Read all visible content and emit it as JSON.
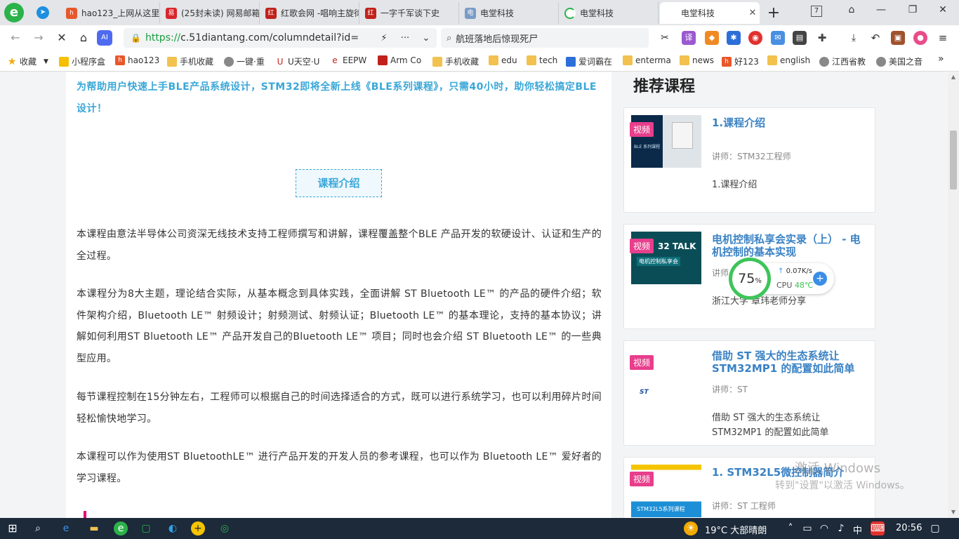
{
  "browser": {
    "tabs": [
      {
        "title": "hao123_上网从这里开始",
        "favicon": "hao123-icon",
        "active": false
      },
      {
        "title": "(25封未读) 网易邮箱",
        "favicon": "netease-mail-icon",
        "active": false
      },
      {
        "title": "红歌会网 -唱响主旋律",
        "favicon": "hongge-icon",
        "active": false
      },
      {
        "title": "一字千军谈下史",
        "favicon": "hongge-icon",
        "active": false
      },
      {
        "title": "电堂科技",
        "favicon": "diantang-icon",
        "active": false
      },
      {
        "title": "电堂科技",
        "favicon": "loading-icon",
        "active": false
      },
      {
        "title": "电堂科技",
        "favicon": "diantang-icon",
        "active": true
      }
    ],
    "pinned_tab_count": "7",
    "url_secure_part": "https://",
    "url_rest": "c.51diantang.com/columndetail?id=",
    "search_text": "航班落地后惊现死尸"
  },
  "bookmarks": [
    {
      "label": "收藏",
      "icon": "star-icon"
    },
    {
      "label": "小程序盒",
      "icon": "shield-icon"
    },
    {
      "label": "hao123",
      "icon": "hao123-icon"
    },
    {
      "label": "手机收藏",
      "icon": "folder-icon"
    },
    {
      "label": "一键·重",
      "icon": "globe-icon"
    },
    {
      "label": "U天空·U",
      "icon": "u-icon"
    },
    {
      "label": "EEPW",
      "icon": "eepw-icon"
    },
    {
      "label": "Arm Co",
      "icon": "arm-icon"
    },
    {
      "label": "手机收藏",
      "icon": "folder-icon"
    },
    {
      "label": "edu",
      "icon": "folder-icon"
    },
    {
      "label": "tech",
      "icon": "folder-icon"
    },
    {
      "label": "爱词霸在",
      "icon": "iciba-icon"
    },
    {
      "label": "enterma",
      "icon": "folder-icon"
    },
    {
      "label": "news",
      "icon": "folder-icon"
    },
    {
      "label": "好123",
      "icon": "hao123-icon"
    },
    {
      "label": "english",
      "icon": "folder-icon"
    },
    {
      "label": "江西省教",
      "icon": "globe-icon"
    },
    {
      "label": "美国之音",
      "icon": "globe-icon"
    }
  ],
  "article": {
    "intro": "为帮助用户快速上手BLE产品系统设计，STM32即将全新上线《BLE系列课程》，只需40小时，助你轻松搞定BLE设计！",
    "section_title": "课程介绍",
    "paragraphs": [
      "本课程由意法半导体公司资深无线技术支持工程师撰写和讲解，课程覆盖整个BLE 产品开发的软硬设计、认证和生产的全过程。",
      "本课程分为8大主题，理论结合实际，从基本概念到具体实践，全面讲解 ST Bluetooth LE™ 的产品的硬件介绍；软件架构介绍，Bluetooth LE™ 射频设计；射频测试、射频认证；Bluetooth LE™ 的基本理论，支持的基本协议；讲解如何利用ST Bluetooth LE™ 产品开发自己的Bluetooth LE™ 项目；同时也会介绍 ST Bluetooth LE™ 的一些典型应用。",
      "每节课程控制在15分钟左右，工程师可以根据自己的时间选择适合的方式，既可以进行系统学习，也可以利用碎片时间轻松愉快地学习。",
      "本课程可以作为使用ST BluetoothLE™ 进行产品开发的开发人员的参考课程，也可以作为 Bluetooth LE™ 爱好者的学习课程。"
    ]
  },
  "sidebar": {
    "title": "推荐课程",
    "cards": [
      {
        "badge": "视频",
        "title": "1.课程介绍",
        "teacher": "讲师：STM32工程师",
        "desc": "1.课程介绍",
        "thumb_text": "BLE 系列课程"
      },
      {
        "badge": "视频",
        "title": "电机控制私享会实录（上） - 电机控制的基本实现",
        "teacher": "讲师",
        "desc": "浙江大学 章玮老师分享",
        "thumb_text": "32 TALK",
        "thumb_sub": "电机控制私享会"
      },
      {
        "badge": "视频",
        "title": "借助 ST 强大的生态系统让 STM32MP1 的配置如此简单",
        "teacher": "讲师：ST",
        "desc": "借助 ST 强大的生态系统让 STM32MP1 的配置如此简单",
        "thumb_text": "ST"
      },
      {
        "badge": "视频",
        "title": "1. STM32L5微控制器简介",
        "teacher": "讲师：ST 工程师",
        "desc": "",
        "thumb_text": "STM32L5系列课程"
      }
    ]
  },
  "cpu_widget": {
    "percent": "75",
    "percent_unit": "%",
    "net_speed": "0.07K/s",
    "cpu_label": "CPU",
    "cpu_temp": "48℃"
  },
  "watermark": {
    "line1": "激活 Windows",
    "line2": "转到\"设置\"以激活 Windows。"
  },
  "taskbar": {
    "weather": "19°C 大部晴朗",
    "ime": "中",
    "time": "20:56"
  },
  "colors": {
    "accent": "#3aa7d8",
    "badge": "#e83e8c",
    "card_title": "#3a82c4",
    "taskbar": "#1c2a3a"
  }
}
